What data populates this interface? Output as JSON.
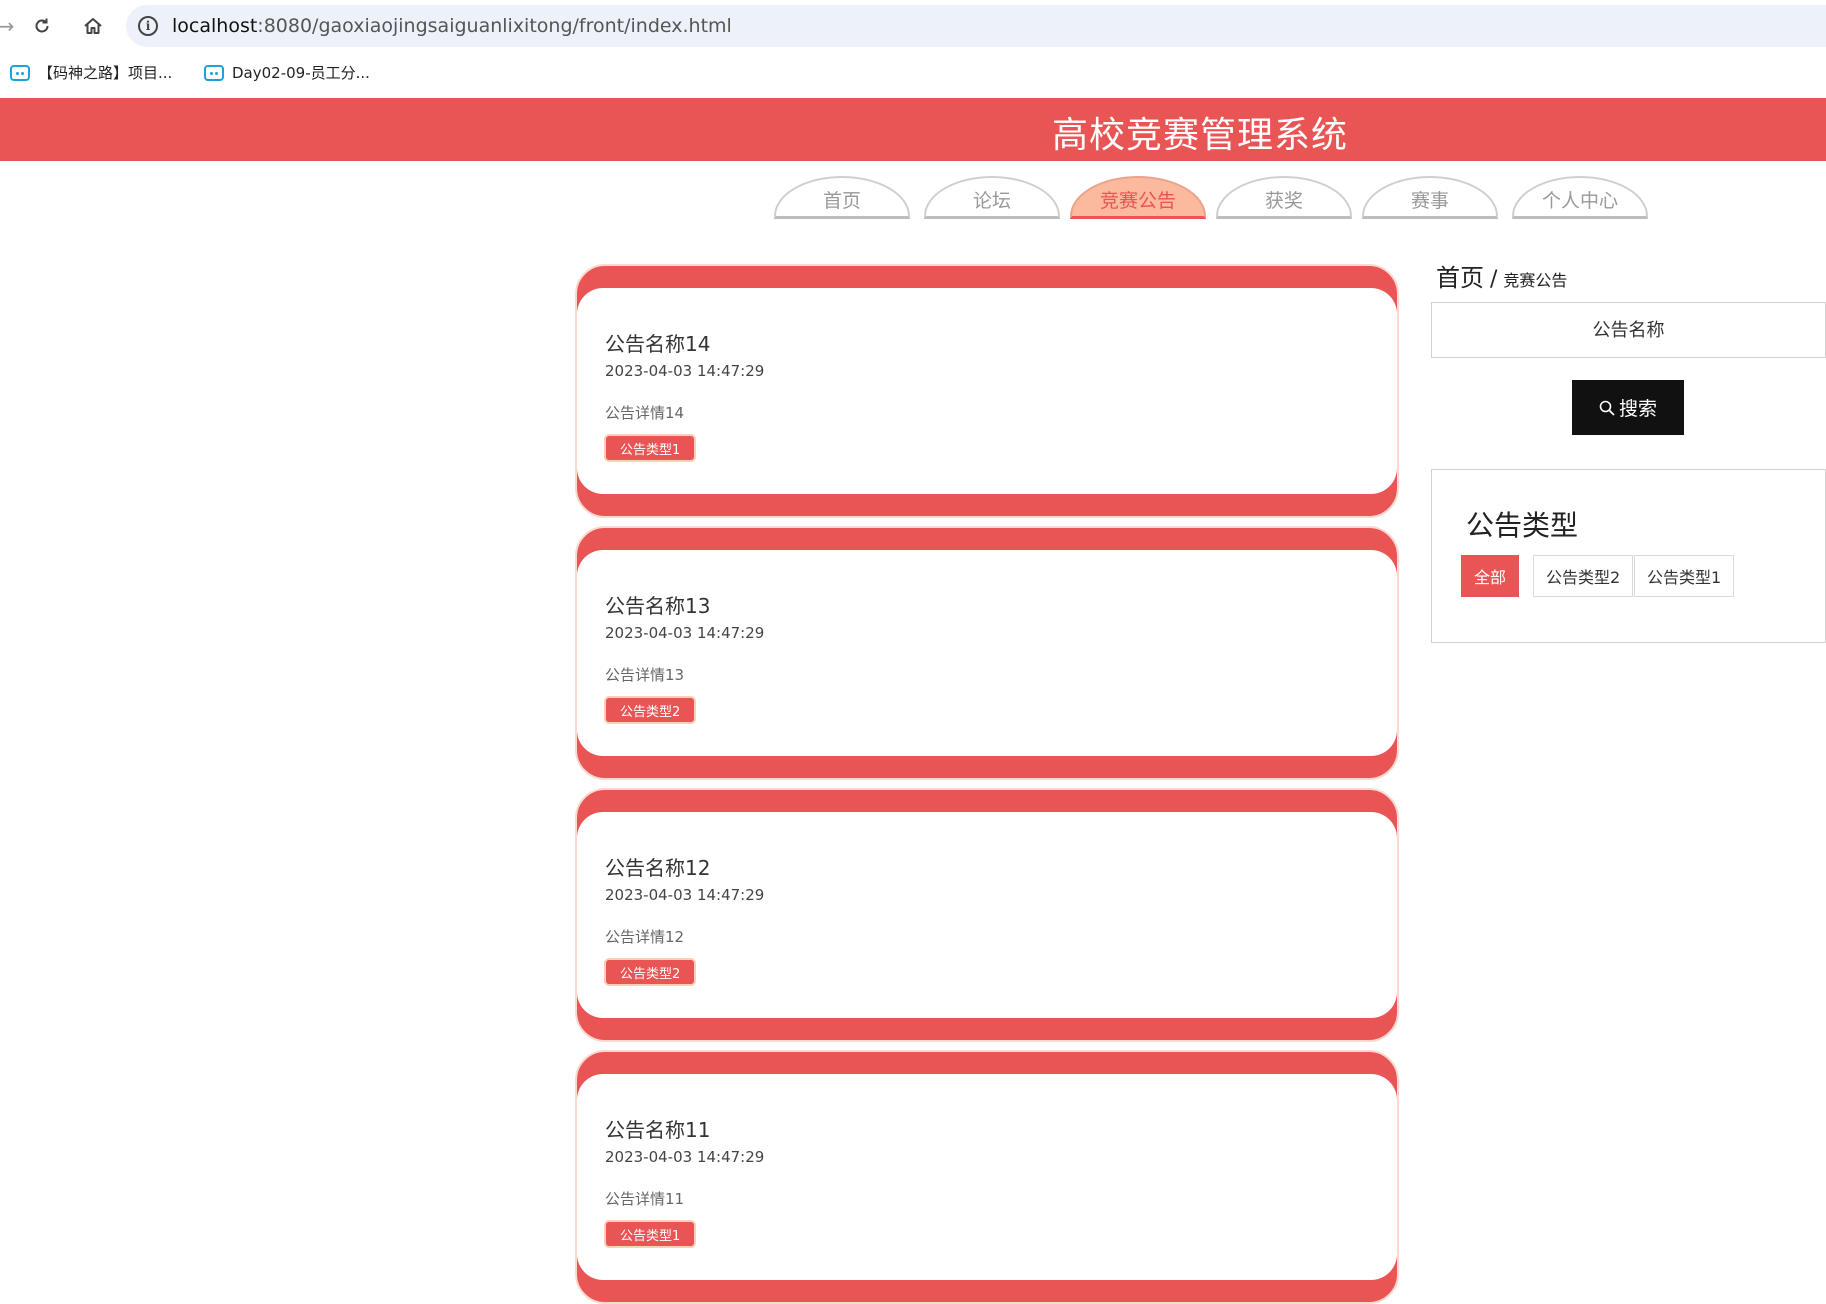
{
  "browser": {
    "url_host": "localhost",
    "url_path": ":8080/gaoxiaojingsaiguanlixitong/front/index.html",
    "bookmarks": [
      {
        "label": "【码神之路】项目..."
      },
      {
        "label": "Day02-09-员工分..."
      }
    ]
  },
  "site": {
    "title": "高校竞赛管理系统"
  },
  "nav": {
    "tabs": [
      {
        "label": "首页"
      },
      {
        "label": "论坛"
      },
      {
        "label": "竞赛公告"
      },
      {
        "label": "获奖"
      },
      {
        "label": "赛事"
      },
      {
        "label": "个人中心"
      }
    ],
    "active": "竞赛公告"
  },
  "notices": [
    {
      "name": "公告名称14",
      "time": "2023-04-03 14:47:29",
      "detail": "公告详情14",
      "type": "公告类型1"
    },
    {
      "name": "公告名称13",
      "time": "2023-04-03 14:47:29",
      "detail": "公告详情13",
      "type": "公告类型2"
    },
    {
      "name": "公告名称12",
      "time": "2023-04-03 14:47:29",
      "detail": "公告详情12",
      "type": "公告类型2"
    },
    {
      "name": "公告名称11",
      "time": "2023-04-03 14:47:29",
      "detail": "公告详情11",
      "type": "公告类型1"
    }
  ],
  "sidebar": {
    "breadcrumb": {
      "home": "首页",
      "separator": "/",
      "current": "竞赛公告"
    },
    "search": {
      "placeholder": "公告名称",
      "value": "",
      "button_label": "搜索"
    },
    "types": {
      "title": "公告类型",
      "options": [
        {
          "label": "全部",
          "active": true
        },
        {
          "label": "公告类型2",
          "active": false
        },
        {
          "label": "公告类型1",
          "active": false
        }
      ]
    }
  },
  "colors": {
    "primary": "#e95554",
    "tab_active_bg": "#fbb99d",
    "search_button": "#111111"
  }
}
